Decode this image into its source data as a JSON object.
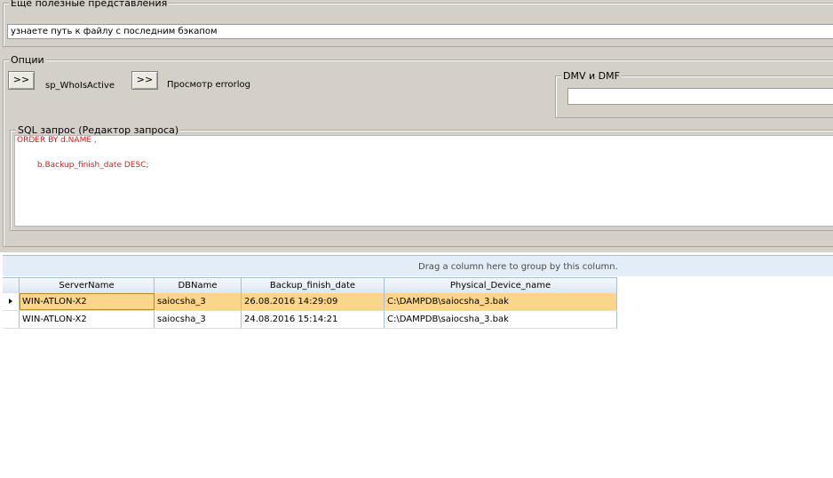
{
  "views_group": {
    "title": "Ещё  полезные представления",
    "selected_view": "узнаете путь к файлу с последним бэкапом"
  },
  "options_group": {
    "title": "Опции",
    "buttons": [
      {
        "label": ">>",
        "caption": "sp_WhoIsActive"
      },
      {
        "label": ">>",
        "caption": "Просмотр errorlog"
      }
    ],
    "dmv": {
      "title": "DMV и DMF",
      "value": ""
    },
    "sql": {
      "title": "SQL запрос (Редактор запроса)",
      "lines": [
        "ORDER BY d.NAME ,",
        "",
        "        b.Backup_finish_date DESC;"
      ]
    }
  },
  "grid": {
    "group_hint": "Drag a column here to group by this column.",
    "columns": [
      "ServerName",
      "DBName",
      "Backup_finish_date",
      "Physical_Device_name"
    ],
    "rows": [
      [
        "WIN-ATLON-X2",
        "saiocsha_3",
        "26.08.2016 14:29:09",
        "C:\\DAMPDB\\saiocsha_3.bak"
      ],
      [
        "WIN-ATLON-X2",
        "saiocsha_3",
        "24.08.2016 15:14:21",
        "C:\\DAMPDB\\saiocsha_3.bak"
      ]
    ],
    "selected_row": 0
  },
  "colors": {
    "window_bg": "#d4d0c8",
    "selected_row": "#fbd68a",
    "sql_text": "#e0201b",
    "grid_border": "#a7bdd9"
  }
}
